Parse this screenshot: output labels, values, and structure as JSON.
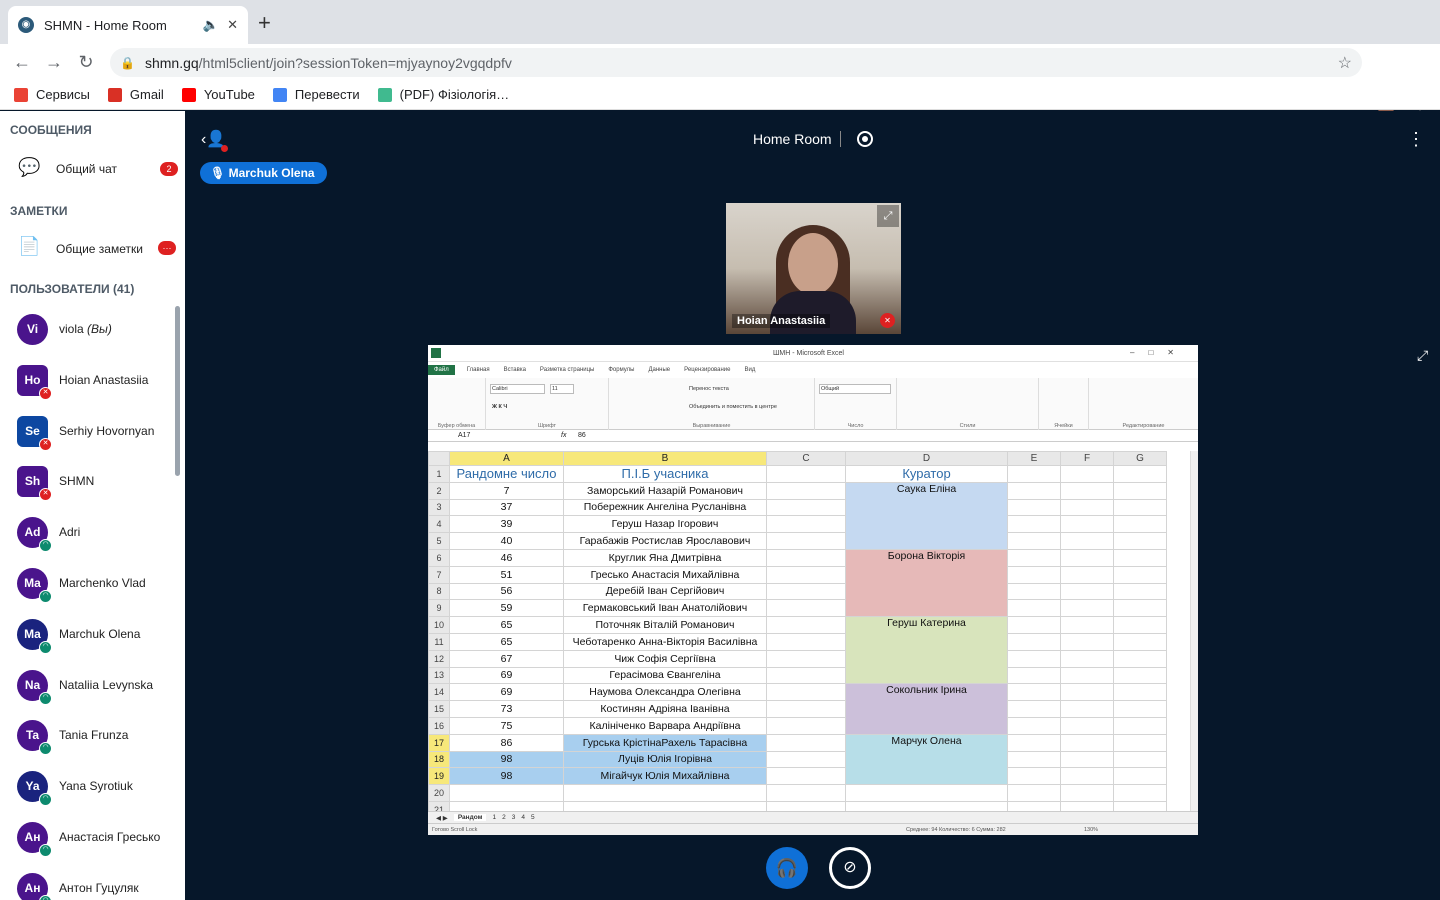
{
  "browser": {
    "tab_title": "SHMN - Home Room",
    "url_host": "shmn.gq",
    "url_path": "/html5client/join?sessionToken=mjyaynoy2vgqdpfv",
    "bookmarks": [
      {
        "label": "Сервисы",
        "color": "#ea4335"
      },
      {
        "label": "Gmail",
        "color": "#d93025"
      },
      {
        "label": "YouTube",
        "color": "#ff0000"
      },
      {
        "label": "Перевести",
        "color": "#4285f4"
      },
      {
        "label": "(PDF) Фізіологія…",
        "color": "#40ba8f"
      }
    ]
  },
  "sidebar": {
    "messages_title": "СООБЩЕНИЯ",
    "public_chat": "Общий чат",
    "chat_badge": "2",
    "notes_title": "ЗАМЕТКИ",
    "shared_notes": "Общие заметки",
    "notes_badge": "···",
    "users_title": "ПОЛЬЗОВАТЕЛИ",
    "users_count": "(41)",
    "users": [
      {
        "initials": "Vi",
        "name": "viola",
        "suffix": "(Вы)",
        "mic": "none",
        "color": "#4a148c",
        "square": false
      },
      {
        "initials": "Ho",
        "name": "Hoian Anastasiia",
        "suffix": "",
        "mic": "muted",
        "color": "#4a148c",
        "square": true
      },
      {
        "initials": "Se",
        "name": "Serhiy Hovornyan",
        "suffix": "",
        "mic": "muted",
        "color": "#0d47a1",
        "square": true
      },
      {
        "initials": "Sh",
        "name": "SHMN",
        "suffix": "",
        "mic": "muted",
        "color": "#4a148c",
        "square": true
      },
      {
        "initials": "Ad",
        "name": "Adri",
        "suffix": "",
        "mic": "listen",
        "color": "#4a148c",
        "square": false
      },
      {
        "initials": "Ma",
        "name": "Marchenko Vlad",
        "suffix": "",
        "mic": "listen",
        "color": "#4a148c",
        "square": false
      },
      {
        "initials": "Ma",
        "name": "Marchuk Olena",
        "suffix": "",
        "mic": "listen",
        "color": "#1a237e",
        "square": false
      },
      {
        "initials": "Na",
        "name": "Nataliia Levynska",
        "suffix": "",
        "mic": "listen",
        "color": "#4a148c",
        "square": false
      },
      {
        "initials": "Ta",
        "name": "Tania Frunza",
        "suffix": "",
        "mic": "listen",
        "color": "#4a148c",
        "square": false
      },
      {
        "initials": "Ya",
        "name": "Yana Syrotiuk",
        "suffix": "",
        "mic": "listen",
        "color": "#1a237e",
        "square": false
      },
      {
        "initials": "Ан",
        "name": "Анастасія Гресько",
        "suffix": "",
        "mic": "listen",
        "color": "#4a148c",
        "square": false
      },
      {
        "initials": "Ан",
        "name": "Антон Гуцуляк",
        "suffix": "",
        "mic": "listen",
        "color": "#4a148c",
        "square": false
      }
    ]
  },
  "main": {
    "room_title": "Home Room",
    "talking": "Marchuk Olena",
    "video_name": "Hoian Anastasiia"
  },
  "excel": {
    "window_title": "ШМН - Microsoft Excel",
    "tabs": [
      "Файл",
      "Главная",
      "Вставка",
      "Разметка страницы",
      "Формулы",
      "Данные",
      "Рецензирование",
      "Вид"
    ],
    "groups": [
      "Буфер обмена",
      "Шрифт",
      "Выравнивание",
      "Число",
      "Стили",
      "Ячейки",
      "Редактирование"
    ],
    "font_name": "Calibri",
    "font_size": "11",
    "number_format": "Общий",
    "wrap_text": "Перенос текста",
    "merge_center": "Объединить и поместить в центре",
    "name_box": "A17",
    "formula_value": "86",
    "columns": [
      "A",
      "B",
      "C",
      "D",
      "E",
      "F",
      "G"
    ],
    "header_a": "Рандомне число",
    "header_b": "П.І.Б учасника",
    "header_d": "Куратор",
    "rows": [
      {
        "n": "2",
        "a": "7",
        "b": "Заморський Назарій Романович"
      },
      {
        "n": "3",
        "a": "37",
        "b": "Побережник Ангеліна Русланівна"
      },
      {
        "n": "4",
        "a": "39",
        "b": "Геруш Назар Ігорович"
      },
      {
        "n": "5",
        "a": "40",
        "b": "Гарабажів Ростислав Ярославович"
      },
      {
        "n": "6",
        "a": "46",
        "b": "Круглик Яна Дмитрівна"
      },
      {
        "n": "7",
        "a": "51",
        "b": "Гресько Анастасія Михайлівна"
      },
      {
        "n": "8",
        "a": "56",
        "b": "Деребій Іван Сергійович"
      },
      {
        "n": "9",
        "a": "59",
        "b": "Гермаковський Іван Анатолійович"
      },
      {
        "n": "10",
        "a": "65",
        "b": "Поточняк Віталій Романович"
      },
      {
        "n": "11",
        "a": "65",
        "b": "Чеботаренко Анна-Вікторія Василівна"
      },
      {
        "n": "12",
        "a": "67",
        "b": "Чиж Софія Сергіївна"
      },
      {
        "n": "13",
        "a": "69",
        "b": "Герасімова Євангеліна"
      },
      {
        "n": "14",
        "a": "69",
        "b": "Наумова Олександра Олегівна"
      },
      {
        "n": "15",
        "a": "73",
        "b": "Костинян Адріяна Іванівна"
      },
      {
        "n": "16",
        "a": "75",
        "b": "Калініченко Варвара Андріївна"
      },
      {
        "n": "17",
        "a": "86",
        "b": "Гурська КрістінаРахель Тарасівна"
      },
      {
        "n": "18",
        "a": "98",
        "b": "Луців Юлія Ігорівна"
      },
      {
        "n": "19",
        "a": "98",
        "b": "Мігайчук Юлія Михайлівна"
      }
    ],
    "curators": [
      {
        "name": "Саука Еліна",
        "color": "#c5d9f1"
      },
      {
        "name": "Борона Вікторія",
        "color": "#e6b9b8"
      },
      {
        "name": "Геруш Катерина",
        "color": "#d8e4bc"
      },
      {
        "name": "Сокольник Ірина",
        "color": "#ccc0da"
      },
      {
        "name": "Марчук Олена",
        "color": "#b7dee8"
      }
    ],
    "sheet_tabs": [
      "Рандом",
      "1",
      "2",
      "3",
      "4",
      "5"
    ],
    "status_left": "Готово   Scroll Lock",
    "status_right": "Среднее: 94   Количество: 6   Сумма: 282",
    "zoom": "130%"
  }
}
